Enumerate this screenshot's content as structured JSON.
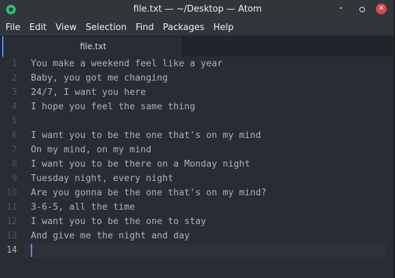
{
  "window": {
    "title": "file.txt — ~/Desktop — Atom",
    "minimize_glyph": "⌄",
    "close_glyph": "✕"
  },
  "menu": [
    "File",
    "Edit",
    "View",
    "Selection",
    "Find",
    "Packages",
    "Help"
  ],
  "tab": {
    "label": "file.txt"
  },
  "editor": {
    "current_line": 14,
    "lines": [
      {
        "num": "1",
        "text": "You make a weekend feel like a year"
      },
      {
        "num": "2",
        "text": "Baby, you got me changing"
      },
      {
        "num": "3",
        "text": "24/7, I want you here"
      },
      {
        "num": "4",
        "text": "I hope you feel the same thing"
      },
      {
        "num": "5",
        "text": ""
      },
      {
        "num": "6",
        "text": "I want you to be the one that's on my mind"
      },
      {
        "num": "7",
        "text": "On my mind, on my mind"
      },
      {
        "num": "8",
        "text": "I want you to be there on a Monday night"
      },
      {
        "num": "9",
        "text": "Tuesday night, every night"
      },
      {
        "num": "10",
        "text": "Are you gonna be the one that's on my mind?"
      },
      {
        "num": "11",
        "text": "3-6-5, all the time"
      },
      {
        "num": "12",
        "text": "I want you to be the one to stay"
      },
      {
        "num": "13",
        "text": "And give me the night and day"
      },
      {
        "num": "14",
        "text": ""
      }
    ]
  },
  "colors": {
    "accent": "#568af2",
    "app_icon": "#2ebf6e",
    "close_button": "#da4453"
  }
}
